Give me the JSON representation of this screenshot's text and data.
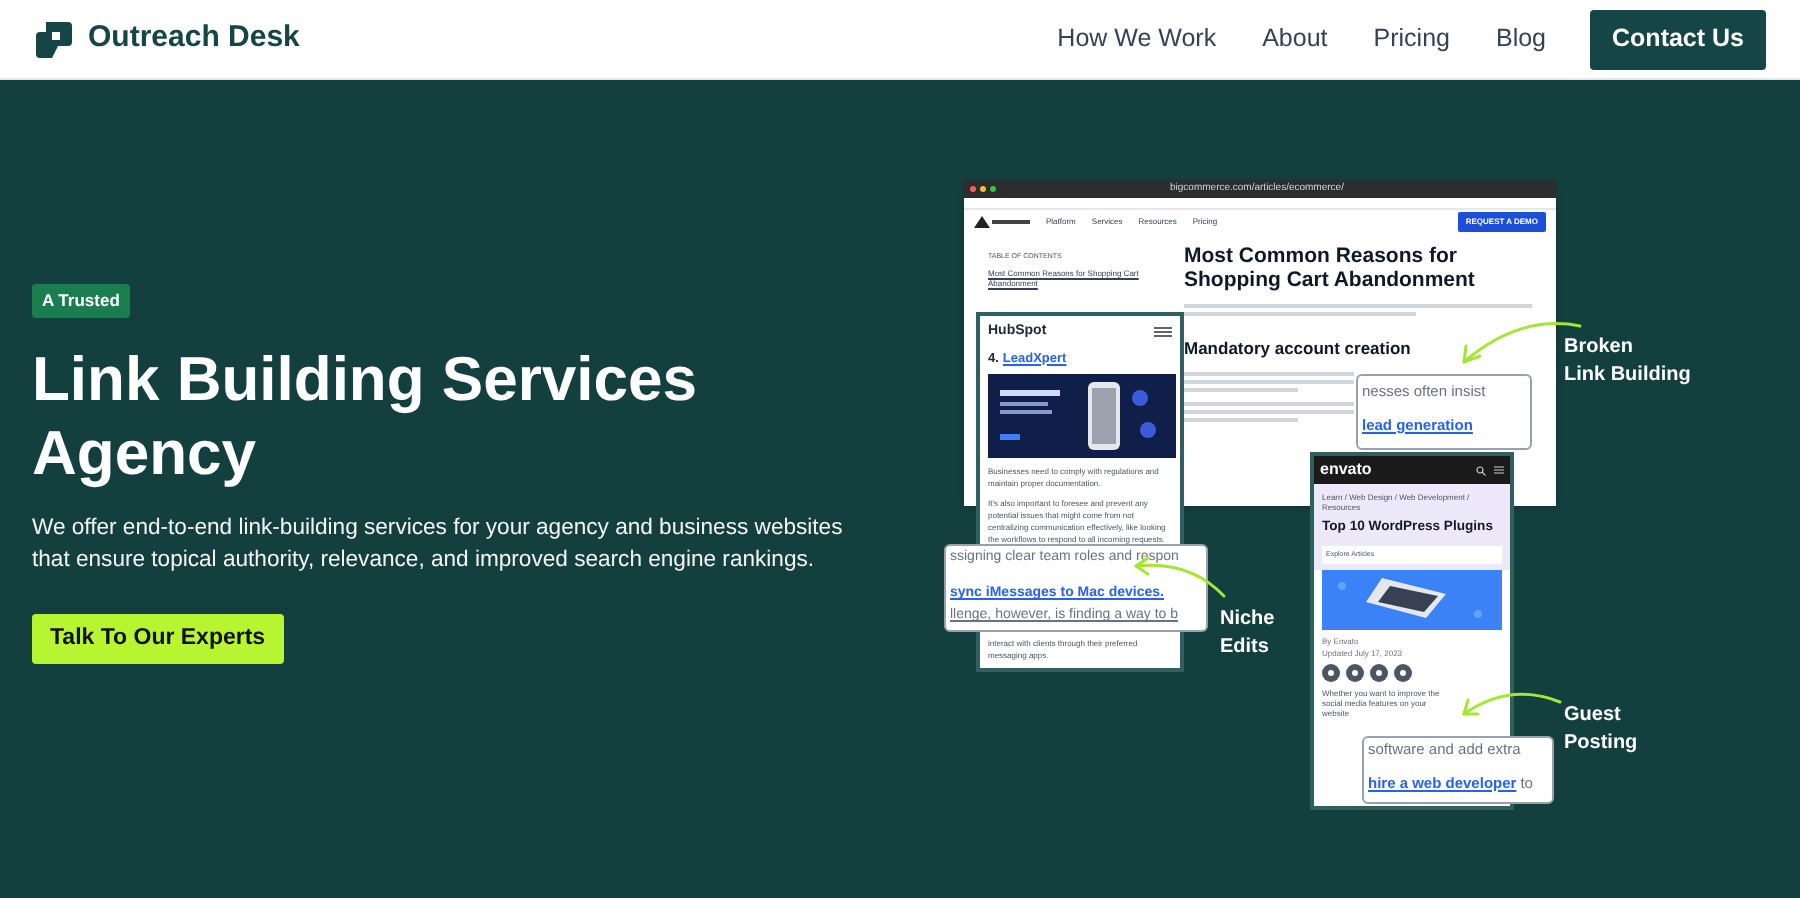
{
  "header": {
    "brand": "Outreach Desk",
    "nav": [
      {
        "label": "How We Work"
      },
      {
        "label": "About"
      },
      {
        "label": "Pricing"
      },
      {
        "label": "Blog"
      }
    ],
    "cta": "Contact Us"
  },
  "hero": {
    "badge": "A Trusted",
    "title": "Link Building Services Agency",
    "description": "We offer end-to-end link-building services for your agency and business websites that ensure topical authority, relevance, and improved search engine rankings.",
    "button": "Talk To Our Experts"
  },
  "illustration": {
    "browser": {
      "url": "bigcommerce.com/articles/ecommerce/",
      "nav": [
        "Platform",
        "Services",
        "Resources",
        "Pricing"
      ],
      "demo_button": "REQUEST A DEMO",
      "toc_label": "TABLE OF CONTENTS",
      "toc_link": "Most Common Reasons for Shopping Cart Abandonment",
      "heading": "Most Common Reasons for Shopping Cart Abandonment",
      "subheading": "Mandatory account creation"
    },
    "hubspot_card": {
      "logo": "HubSpot",
      "number": "4.",
      "link": "LeadXpert",
      "paragraphs": [
        "Businesses need to comply with regulations and maintain proper documentation.",
        "It's also important to foresee and prevent any potential issues that might come from not centralizing communication effectively, like looking the workflows to respond to all incoming requests."
      ],
      "footer": "interact with clients through their preferred messaging apps."
    },
    "envato_card": {
      "logo": "envato",
      "breadcrumb": "Learn / Web Design / Web Development / Resources",
      "title": "Top 10 WordPress Plugins",
      "dropdown": "Explore Articles",
      "byline": "By Envato",
      "updated": "Updated July 17, 2023",
      "paragraph": "Whether you want to improve the social media features on your website"
    },
    "callouts": [
      {
        "kind": "broken",
        "before": "nesses often insist",
        "link": "lead generation",
        "label": [
          "Broken",
          "Link Building"
        ]
      },
      {
        "kind": "niche",
        "before": "ssigning clear team roles and respon",
        "link": "sync iMessages to Mac devices.",
        "after": "llenge, however, is finding a way to b",
        "label": [
          "Niche",
          "Edits"
        ]
      },
      {
        "kind": "guest",
        "before": "software and add extra",
        "link": "hire a web developer",
        "after": "to",
        "label": [
          "Guest",
          "Posting"
        ]
      }
    ]
  }
}
